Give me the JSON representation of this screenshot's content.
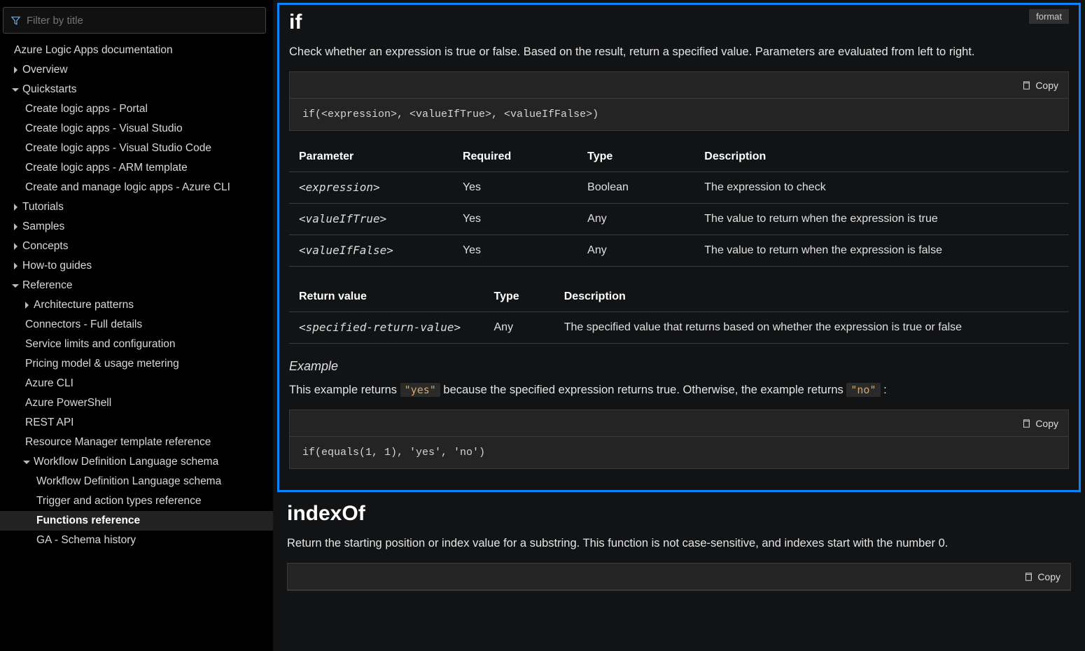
{
  "sidebar": {
    "filter_placeholder": "Filter by title",
    "root": "Azure Logic Apps documentation",
    "items": [
      {
        "label": "Overview",
        "level": 0,
        "chev": true,
        "open": false
      },
      {
        "label": "Quickstarts",
        "level": 0,
        "chev": true,
        "open": true
      },
      {
        "label": "Create logic apps - Portal",
        "level": 1
      },
      {
        "label": "Create logic apps - Visual Studio",
        "level": 1
      },
      {
        "label": "Create logic apps - Visual Studio Code",
        "level": 1
      },
      {
        "label": "Create logic apps - ARM template",
        "level": 1
      },
      {
        "label": "Create and manage logic apps - Azure CLI",
        "level": 1
      },
      {
        "label": "Tutorials",
        "level": 0,
        "chev": true,
        "open": false
      },
      {
        "label": "Samples",
        "level": 0,
        "chev": true,
        "open": false
      },
      {
        "label": "Concepts",
        "level": 0,
        "chev": true,
        "open": false
      },
      {
        "label": "How-to guides",
        "level": 0,
        "chev": true,
        "open": false
      },
      {
        "label": "Reference",
        "level": 0,
        "chev": true,
        "open": true
      },
      {
        "label": "Architecture patterns",
        "level": 1,
        "chev": true,
        "open": false
      },
      {
        "label": "Connectors - Full details",
        "level": 1
      },
      {
        "label": "Service limits and configuration",
        "level": 1
      },
      {
        "label": "Pricing model & usage metering",
        "level": 1
      },
      {
        "label": "Azure CLI",
        "level": 1
      },
      {
        "label": "Azure PowerShell",
        "level": 1
      },
      {
        "label": "REST API",
        "level": 1
      },
      {
        "label": "Resource Manager template reference",
        "level": 1
      },
      {
        "label": "Workflow Definition Language schema",
        "level": 1,
        "chev": true,
        "open": true
      },
      {
        "label": "Workflow Definition Language schema",
        "level": 2
      },
      {
        "label": "Trigger and action types reference",
        "level": 2
      },
      {
        "label": "Functions reference",
        "level": 2,
        "active": true
      },
      {
        "label": "GA - Schema history",
        "level": 2
      }
    ]
  },
  "main": {
    "format_tag": "format",
    "copy_label": "Copy",
    "if": {
      "title": "if",
      "desc": "Check whether an expression is true or false. Based on the result, return a specified value. Parameters are evaluated from left to right.",
      "code1": "if(<expression>, <valueIfTrue>, <valueIfFalse>)",
      "params_head": [
        "Parameter",
        "Required",
        "Type",
        "Description"
      ],
      "params": [
        {
          "p": "<expression>",
          "r": "Yes",
          "t": "Boolean",
          "d": "The expression to check"
        },
        {
          "p": "<valueIfTrue>",
          "r": "Yes",
          "t": "Any",
          "d": "The value to return when the expression is true"
        },
        {
          "p": "<valueIfFalse>",
          "r": "Yes",
          "t": "Any",
          "d": "The value to return when the expression is false"
        }
      ],
      "ret_head": [
        "Return value",
        "Type",
        "Description"
      ],
      "ret": {
        "v": "<specified-return-value>",
        "t": "Any",
        "d": "The specified value that returns based on whether the expression is true or false"
      },
      "example_h": "Example",
      "ex_pre": "This example returns ",
      "ex_c1": "\"yes\"",
      "ex_mid": " because the specified expression returns true. Otherwise, the example returns ",
      "ex_c2": "\"no\"",
      "ex_post": " :",
      "code2": "if(equals(1, 1), 'yes', 'no')"
    },
    "indexOf": {
      "title": "indexOf",
      "desc": "Return the starting position or index value for a substring. This function is not case-sensitive, and indexes start with the number 0."
    }
  }
}
